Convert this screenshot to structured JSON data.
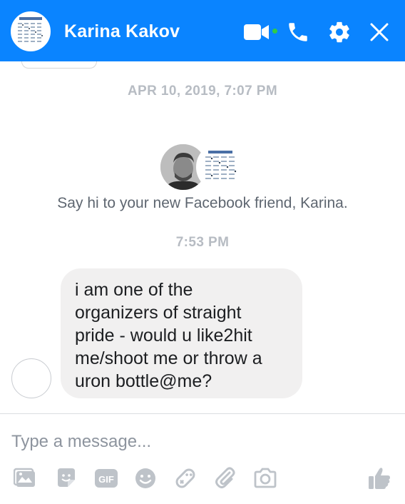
{
  "header": {
    "title": "Karina Kakov",
    "bg_color": "#0a84ff",
    "icons": [
      "video-camera-icon",
      "phone-icon",
      "gear-icon",
      "close-icon"
    ]
  },
  "messages": {
    "date_separator_1": "APR 10, 2019, 7:07 PM",
    "friend_note": "Say hi to your new Facebook friend, Karina.",
    "date_separator_2": "7:53 PM",
    "incoming_text": "i am one of the\norganizers of straight\npride - would u like2hit\nme/shoot me or throw a\nuron bottle@me?"
  },
  "composer": {
    "placeholder": "Type a message...",
    "toolbar_icons": [
      "photo-icon",
      "sticker-icon",
      "gif-icon",
      "emoji-icon",
      "game-icon",
      "attachment-icon",
      "camera-icon",
      "like-icon"
    ],
    "gif_label": "GIF"
  },
  "colors": {
    "accent": "#0a84ff",
    "online": "#31cc46",
    "bubble": "#f1f0f0",
    "icon_gray": "#bec3c9"
  }
}
